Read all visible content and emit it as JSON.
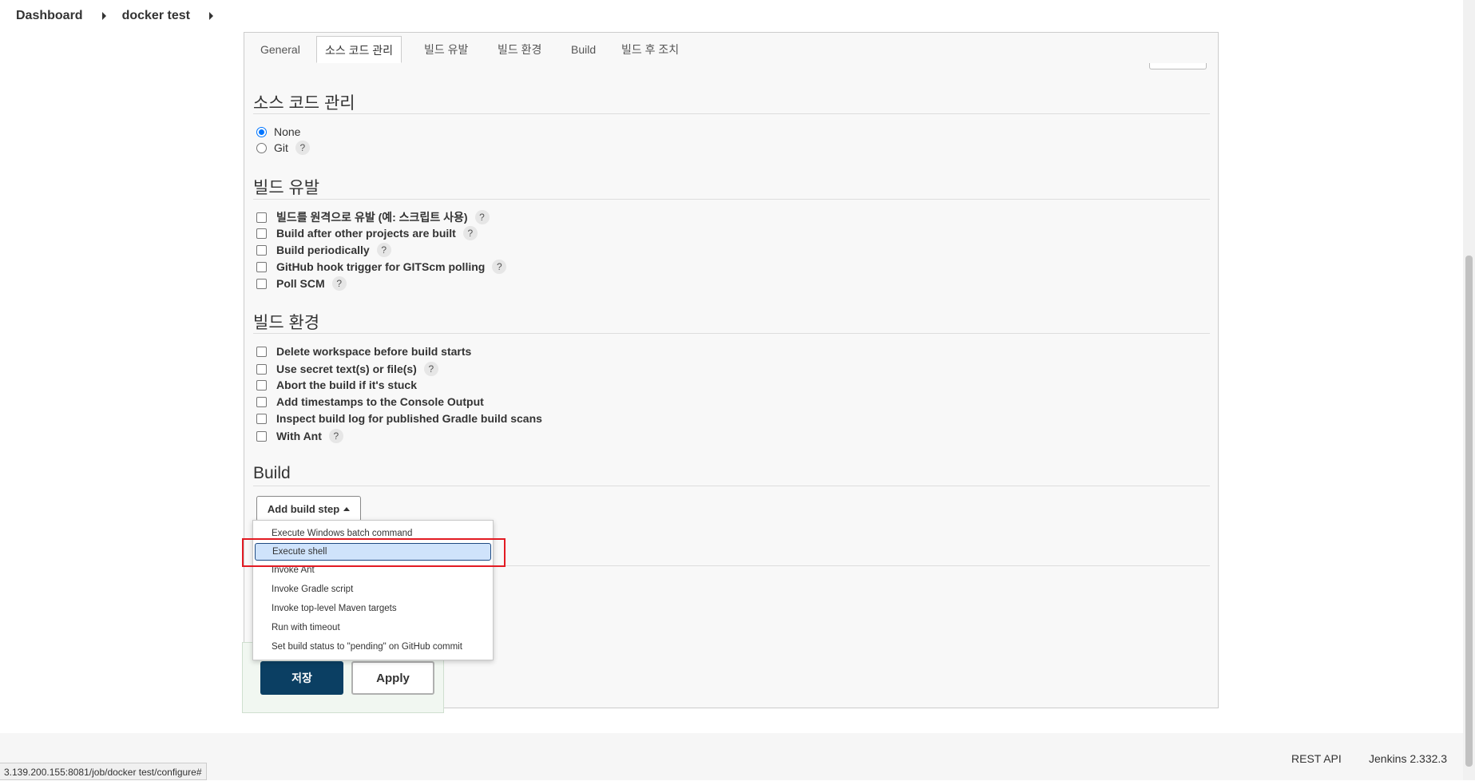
{
  "breadcrumb": {
    "items": [
      "Dashboard",
      "docker test"
    ]
  },
  "tabs": [
    "General",
    "소스 코드 관리",
    "빌드 유발",
    "빌드 환경",
    "Build",
    "빌드 후 조치"
  ],
  "active_tab": "소스 코드 관리",
  "scm": {
    "title": "소스 코드 관리",
    "options": [
      {
        "label": "None",
        "selected": true
      },
      {
        "label": "Git",
        "selected": false
      }
    ],
    "help": "?"
  },
  "triggers": {
    "title": "빌드 유발",
    "options": [
      "빌드를 원격으로 유발 (예: 스크립트 사용)",
      "Build after other projects are built",
      "Build periodically",
      "GitHub hook trigger for GITScm polling",
      "Poll SCM"
    ],
    "help": "?"
  },
  "build_env": {
    "title": "빌드 환경",
    "options": [
      "Delete workspace before build starts",
      "Use secret text(s) or file(s)",
      "Abort the build if it's stuck",
      "Add timestamps to the Console Output",
      "Inspect build log for published Gradle build scans",
      "With Ant"
    ],
    "help": "?"
  },
  "build": {
    "title": "Build",
    "add_step_label": "Add build step"
  },
  "dropdown": {
    "items": [
      "Execute Windows batch command",
      "Execute shell",
      "Invoke Ant",
      "Invoke Gradle script",
      "Invoke top-level Maven targets",
      "Run with timeout",
      "Set build status to \"pending\" on GitHub commit"
    ],
    "selected": "Execute shell",
    "highlight_color": "#e21b23"
  },
  "actions": {
    "save_label": "저장",
    "apply_label": "Apply",
    "save_color": "#0b3f63"
  },
  "footer": {
    "rest_api": "REST API",
    "version": "Jenkins 2.332.3"
  },
  "status_url": "3.139.200.155:8081/job/docker test/configure#"
}
